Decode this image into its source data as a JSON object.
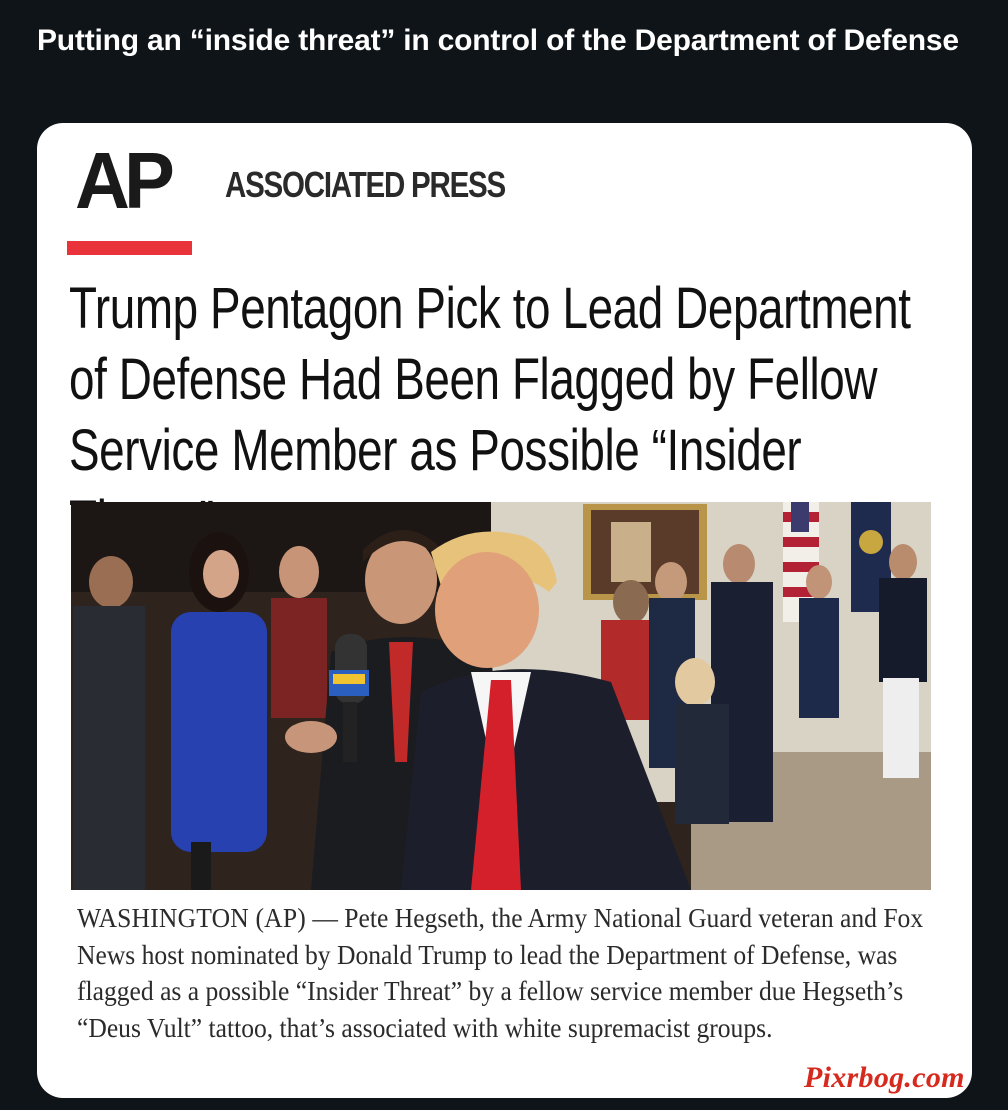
{
  "post": {
    "title": "Putting an “inside threat” in control of the Department of Defense"
  },
  "card": {
    "logo_text": "AP",
    "publisher": "ASSOCIATED PRESS",
    "headline": "Trump Pentagon Pick to Lead Department of Defense Had Been Flagged by Fellow Service Member as Possible “Insider Threat”",
    "dateline": "WASHINGTON (AP)",
    "caption_body": " — Pete Hegseth, the Army National Guard veteran and Fox News host nominated by Donald Trump to lead the Department of Defense, was flagged as a possible “Insider Threat” by a fellow service member due Hegseth’s “Deus Vult” tattoo, that’s associated with white supremacist groups.",
    "photo": {
      "icon": "news-photo",
      "mic_flag_text": "FOX"
    }
  },
  "watermark": "Pixrbog.com",
  "colors": {
    "page_bg": "#0f1419",
    "card_bg": "#ffffff",
    "ap_red": "#e8333b",
    "watermark_red": "#d62a1e"
  }
}
